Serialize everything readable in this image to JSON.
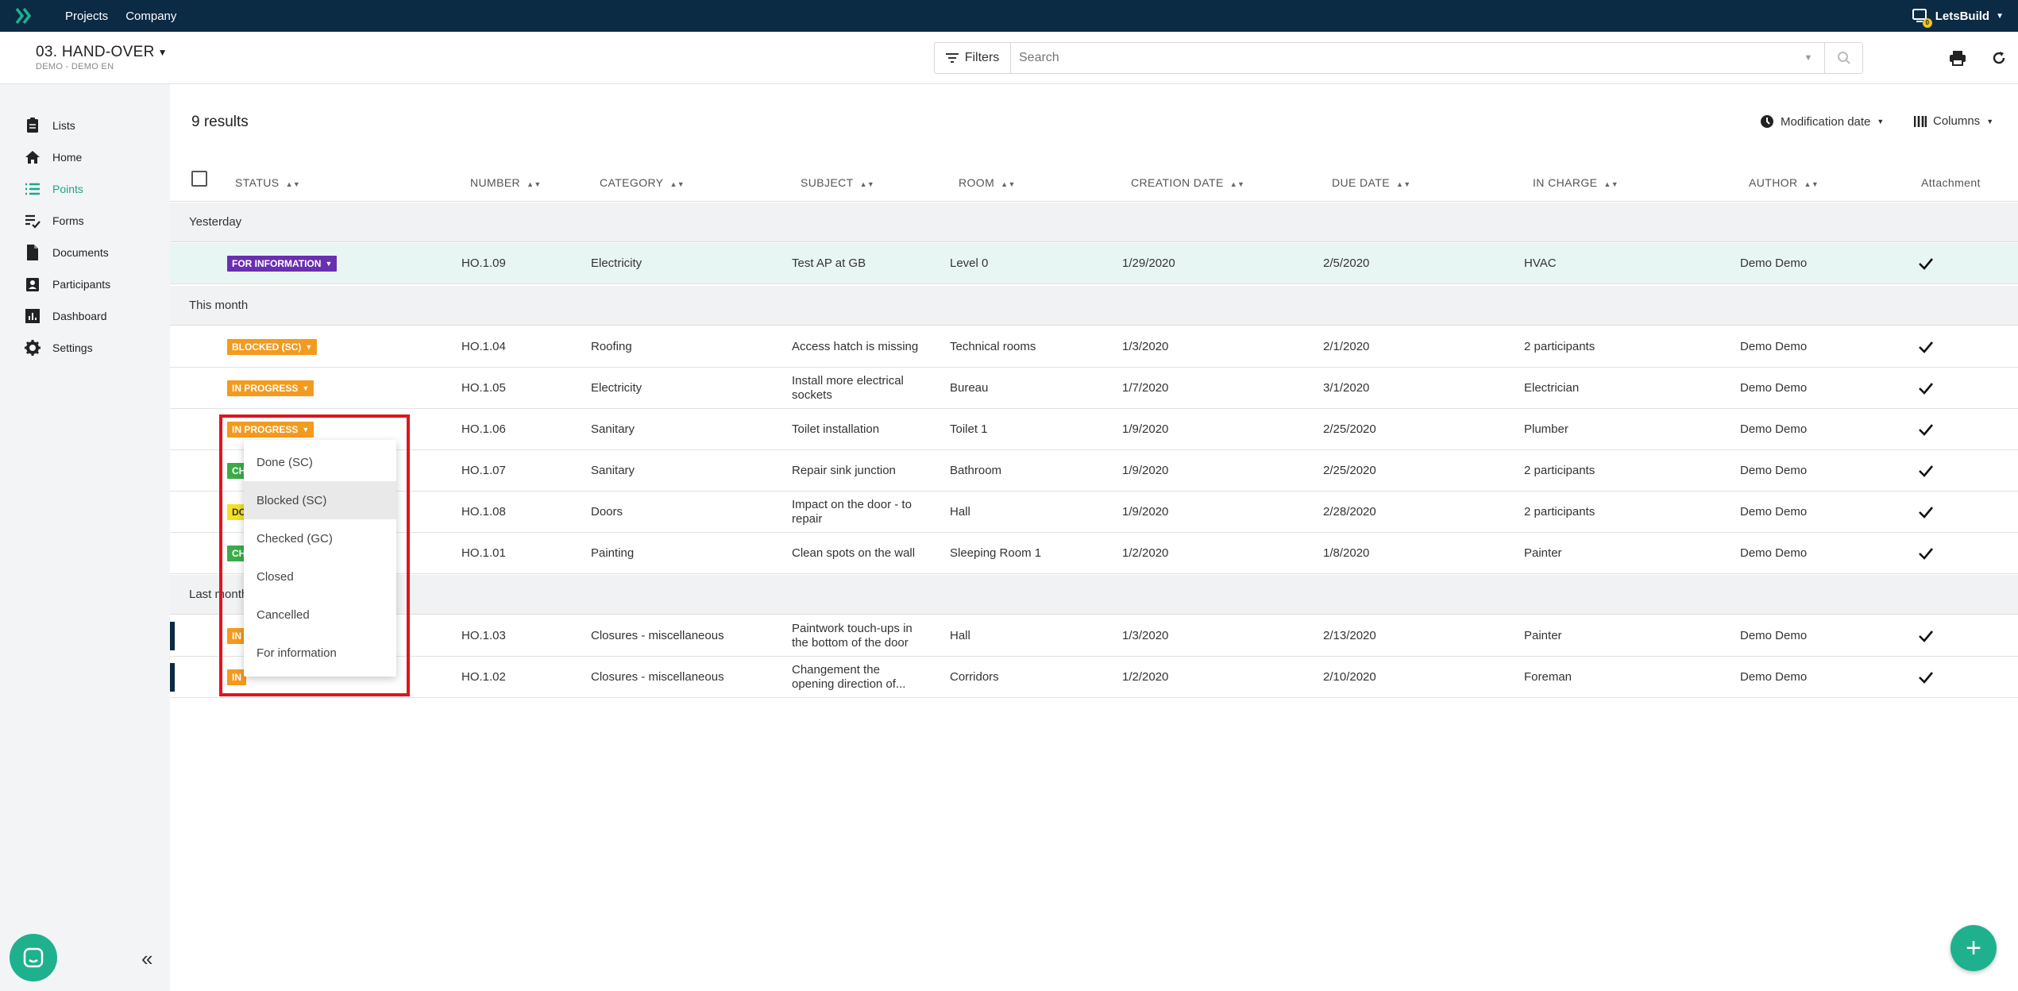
{
  "topbar": {
    "nav": [
      "Projects",
      "Company"
    ],
    "user": "LetsBuild",
    "notification_count": "0"
  },
  "project": {
    "title": "03. HAND-OVER",
    "subtitle": "DEMO - DEMO EN"
  },
  "search": {
    "filters_label": "Filters",
    "placeholder": "Search"
  },
  "sidebar": {
    "items": [
      {
        "label": "Lists",
        "icon": "clipboard-icon"
      },
      {
        "label": "Home",
        "icon": "home-icon"
      },
      {
        "label": "Points",
        "icon": "list-icon",
        "active": true
      },
      {
        "label": "Forms",
        "icon": "form-check-icon"
      },
      {
        "label": "Documents",
        "icon": "document-icon"
      },
      {
        "label": "Participants",
        "icon": "participants-icon"
      },
      {
        "label": "Dashboard",
        "icon": "dashboard-icon"
      },
      {
        "label": "Settings",
        "icon": "gear-icon"
      }
    ]
  },
  "results_label": "9 results",
  "sort": {
    "label": "Modification date"
  },
  "columns_label": "Columns",
  "table": {
    "headers": [
      "STATUS",
      "NUMBER",
      "CATEGORY",
      "SUBJECT",
      "ROOM",
      "CREATION DATE",
      "DUE DATE",
      "IN CHARGE",
      "AUTHOR",
      "Attachment"
    ],
    "groups": [
      "Yesterday",
      "This month",
      "Last month"
    ],
    "rows": [
      {
        "status": "FOR INFORMATION",
        "status_color": "#6a2fb0",
        "number": "HO.1.09",
        "category": "Electricity",
        "subject": "Test AP at GB",
        "room": "Level 0",
        "created": "1/29/2020",
        "due": "2/5/2020",
        "in_charge": "HVAC",
        "author": "Demo Demo"
      },
      {
        "status": "BLOCKED (SC)",
        "status_color": "#f39a1f",
        "number": "HO.1.04",
        "category": "Roofing",
        "subject": "Access hatch is missing",
        "room": "Technical rooms",
        "created": "1/3/2020",
        "due": "2/1/2020",
        "in_charge": "2 participants",
        "author": "Demo Demo"
      },
      {
        "status": "IN PROGRESS",
        "status_color": "#f39a1f",
        "number": "HO.1.05",
        "category": "Electricity",
        "subject": "Install more electrical sockets",
        "room": "Bureau",
        "created": "1/7/2020",
        "due": "3/1/2020",
        "in_charge": "Electrician",
        "author": "Demo Demo"
      },
      {
        "status": "IN PROGRESS",
        "status_color": "#f39a1f",
        "number": "HO.1.06",
        "category": "Sanitary",
        "subject": "Toilet installation",
        "room": "Toilet 1",
        "created": "1/9/2020",
        "due": "2/25/2020",
        "in_charge": "Plumber",
        "author": "Demo Demo"
      },
      {
        "status": "CH",
        "status_color": "#3cab4a",
        "number": "HO.1.07",
        "category": "Sanitary",
        "subject": "Repair sink junction",
        "room": "Bathroom",
        "created": "1/9/2020",
        "due": "2/25/2020",
        "in_charge": "2 participants",
        "author": "Demo Demo"
      },
      {
        "status": "DO",
        "status_color": "#f3e227",
        "number": "HO.1.08",
        "category": "Doors",
        "subject": "Impact on the door - to repair",
        "room": "Hall",
        "created": "1/9/2020",
        "due": "2/28/2020",
        "in_charge": "2 participants",
        "author": "Demo Demo"
      },
      {
        "status": "CH",
        "status_color": "#3cab4a",
        "number": "HO.1.01",
        "category": "Painting",
        "subject": "Clean spots on the wall",
        "room": "Sleeping Room 1",
        "created": "1/2/2020",
        "due": "1/8/2020",
        "in_charge": "Painter",
        "author": "Demo Demo"
      },
      {
        "status": "IN",
        "status_color": "#f39a1f",
        "number": "HO.1.03",
        "category": "Closures - miscellaneous",
        "subject": "Paintwork touch-ups in the bottom of the door",
        "room": "Hall",
        "created": "1/3/2020",
        "due": "2/13/2020",
        "in_charge": "Painter",
        "author": "Demo Demo"
      },
      {
        "status": "IN",
        "status_color": "#f39a1f",
        "number": "HO.1.02",
        "category": "Closures - miscellaneous",
        "subject": "Changement the opening direction of...",
        "room": "Corridors",
        "created": "1/2/2020",
        "due": "2/10/2020",
        "in_charge": "Foreman",
        "author": "Demo Demo"
      }
    ]
  },
  "status_menu": {
    "options": [
      "Done (SC)",
      "Blocked (SC)",
      "Checked (GC)",
      "Closed",
      "Cancelled",
      "For information"
    ],
    "highlighted": "Blocked (SC)"
  },
  "colors": {
    "accent": "#1fb18e",
    "topbar": "#0b2a44",
    "highlight_box": "#e0141e"
  }
}
